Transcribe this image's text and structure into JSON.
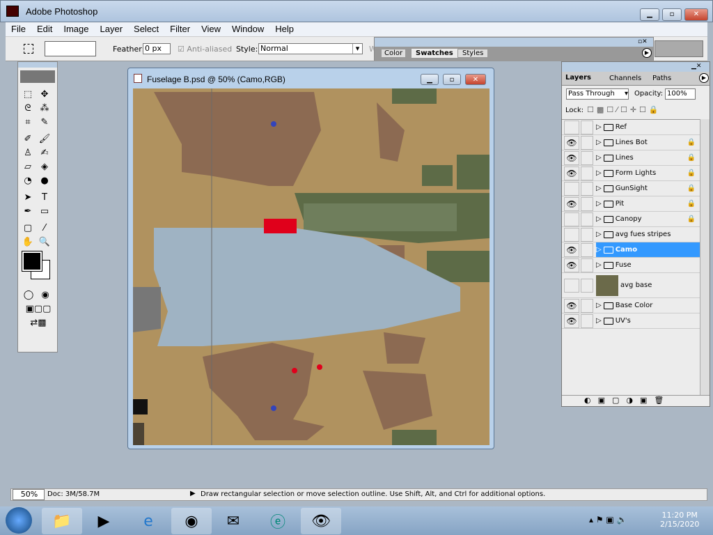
{
  "app": {
    "title": "Adobe Photoshop"
  },
  "menu": [
    "File",
    "Edit",
    "Image",
    "Layer",
    "Select",
    "Filter",
    "View",
    "Window",
    "Help"
  ],
  "options": {
    "feather_label": "Feather:",
    "feather_value": "0 px",
    "antialiased_label": "Anti-aliased",
    "style_label": "Style:",
    "style_value": "Normal",
    "truncated_label": "W"
  },
  "swatches_panel": {
    "tabs": [
      "Color",
      "Swatches",
      "Styles"
    ],
    "active_tab": "Swatches"
  },
  "document": {
    "title": "Fuselage B.psd @ 50% (Camo,RGB)"
  },
  "layers_panel": {
    "tabs": [
      "Layers",
      "Channels",
      "Paths"
    ],
    "active_tab": "Layers",
    "blend_mode": "Pass Through",
    "opacity_label": "Opacity:",
    "opacity_value": "100%",
    "lock_label": "Lock:",
    "layers": [
      {
        "name": "Ref",
        "visible": false,
        "locked": false,
        "type": "folder"
      },
      {
        "name": "Lines Bot",
        "visible": true,
        "locked": true,
        "type": "folder"
      },
      {
        "name": "Lines",
        "visible": true,
        "locked": true,
        "type": "folder"
      },
      {
        "name": "Form Lights",
        "visible": true,
        "locked": true,
        "type": "folder"
      },
      {
        "name": "GunSight",
        "visible": false,
        "locked": true,
        "type": "folder"
      },
      {
        "name": "Pit",
        "visible": true,
        "locked": true,
        "type": "folder"
      },
      {
        "name": "Canopy",
        "visible": false,
        "locked": true,
        "type": "folder"
      },
      {
        "name": "avg fues stripes",
        "visible": false,
        "locked": false,
        "type": "folder"
      },
      {
        "name": "Camo",
        "visible": true,
        "locked": false,
        "type": "folder",
        "selected": true
      },
      {
        "name": "Fuse",
        "visible": true,
        "locked": false,
        "type": "folder"
      },
      {
        "name": "avg base",
        "visible": false,
        "locked": false,
        "type": "layer"
      },
      {
        "name": "Base Color",
        "visible": true,
        "locked": false,
        "type": "folder"
      },
      {
        "name": "UV's",
        "visible": true,
        "locked": false,
        "type": "folder"
      }
    ]
  },
  "status": {
    "zoom": "50%",
    "doc": "Doc: 3M/58.7M",
    "hint": "Draw rectangular selection or move selection outline.  Use Shift, Alt, and Ctrl for additional options."
  },
  "taskbar": {
    "time": "11:20 PM",
    "date": "2/15/2020"
  },
  "colors": {
    "selected": "#3399ff",
    "tan": "#b0925f",
    "brown": "#8c6a52",
    "blue": "#9fb3c3",
    "green": "#5d6b47",
    "red": "#e0001b"
  }
}
